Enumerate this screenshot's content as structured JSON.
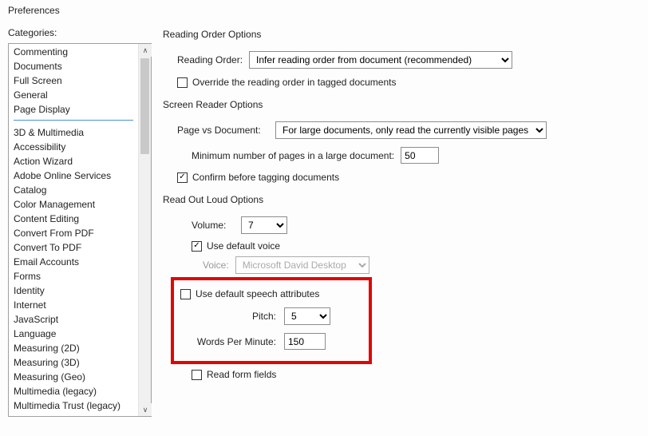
{
  "window_title": "Preferences",
  "categories_label": "Categories:",
  "categories_top": [
    "Commenting",
    "Documents",
    "Full Screen",
    "General",
    "Page Display"
  ],
  "categories_bottom": [
    "3D & Multimedia",
    "Accessibility",
    "Action Wizard",
    "Adobe Online Services",
    "Catalog",
    "Color Management",
    "Content Editing",
    "Convert From PDF",
    "Convert To PDF",
    "Email Accounts",
    "Forms",
    "Identity",
    "Internet",
    "JavaScript",
    "Language",
    "Measuring (2D)",
    "Measuring (3D)",
    "Measuring (Geo)",
    "Multimedia (legacy)",
    "Multimedia Trust (legacy)"
  ],
  "reading_order": {
    "legend": "Reading Order Options",
    "order_label": "Reading Order:",
    "order_value": "Infer reading order from document (recommended)",
    "override_label": "Override the reading order in tagged documents",
    "override_checked": false
  },
  "screen_reader": {
    "legend": "Screen Reader Options",
    "page_vs_doc_label": "Page vs Document:",
    "page_vs_doc_value": "For large documents, only read the currently visible pages",
    "min_pages_label": "Minimum number of pages in a large document:",
    "min_pages_value": "50",
    "confirm_label": "Confirm before tagging documents",
    "confirm_checked": true
  },
  "read_out_loud": {
    "legend": "Read Out Loud Options",
    "volume_label": "Volume:",
    "volume_value": "7",
    "use_default_voice_label": "Use default voice",
    "use_default_voice_checked": true,
    "voice_label": "Voice:",
    "voice_value": "Microsoft David Desktop",
    "use_default_speech_label": "Use default speech attributes",
    "use_default_speech_checked": false,
    "pitch_label": "Pitch:",
    "pitch_value": "5",
    "wpm_label": "Words Per Minute:",
    "wpm_value": "150",
    "read_form_fields_label": "Read form fields",
    "read_form_fields_checked": false
  }
}
